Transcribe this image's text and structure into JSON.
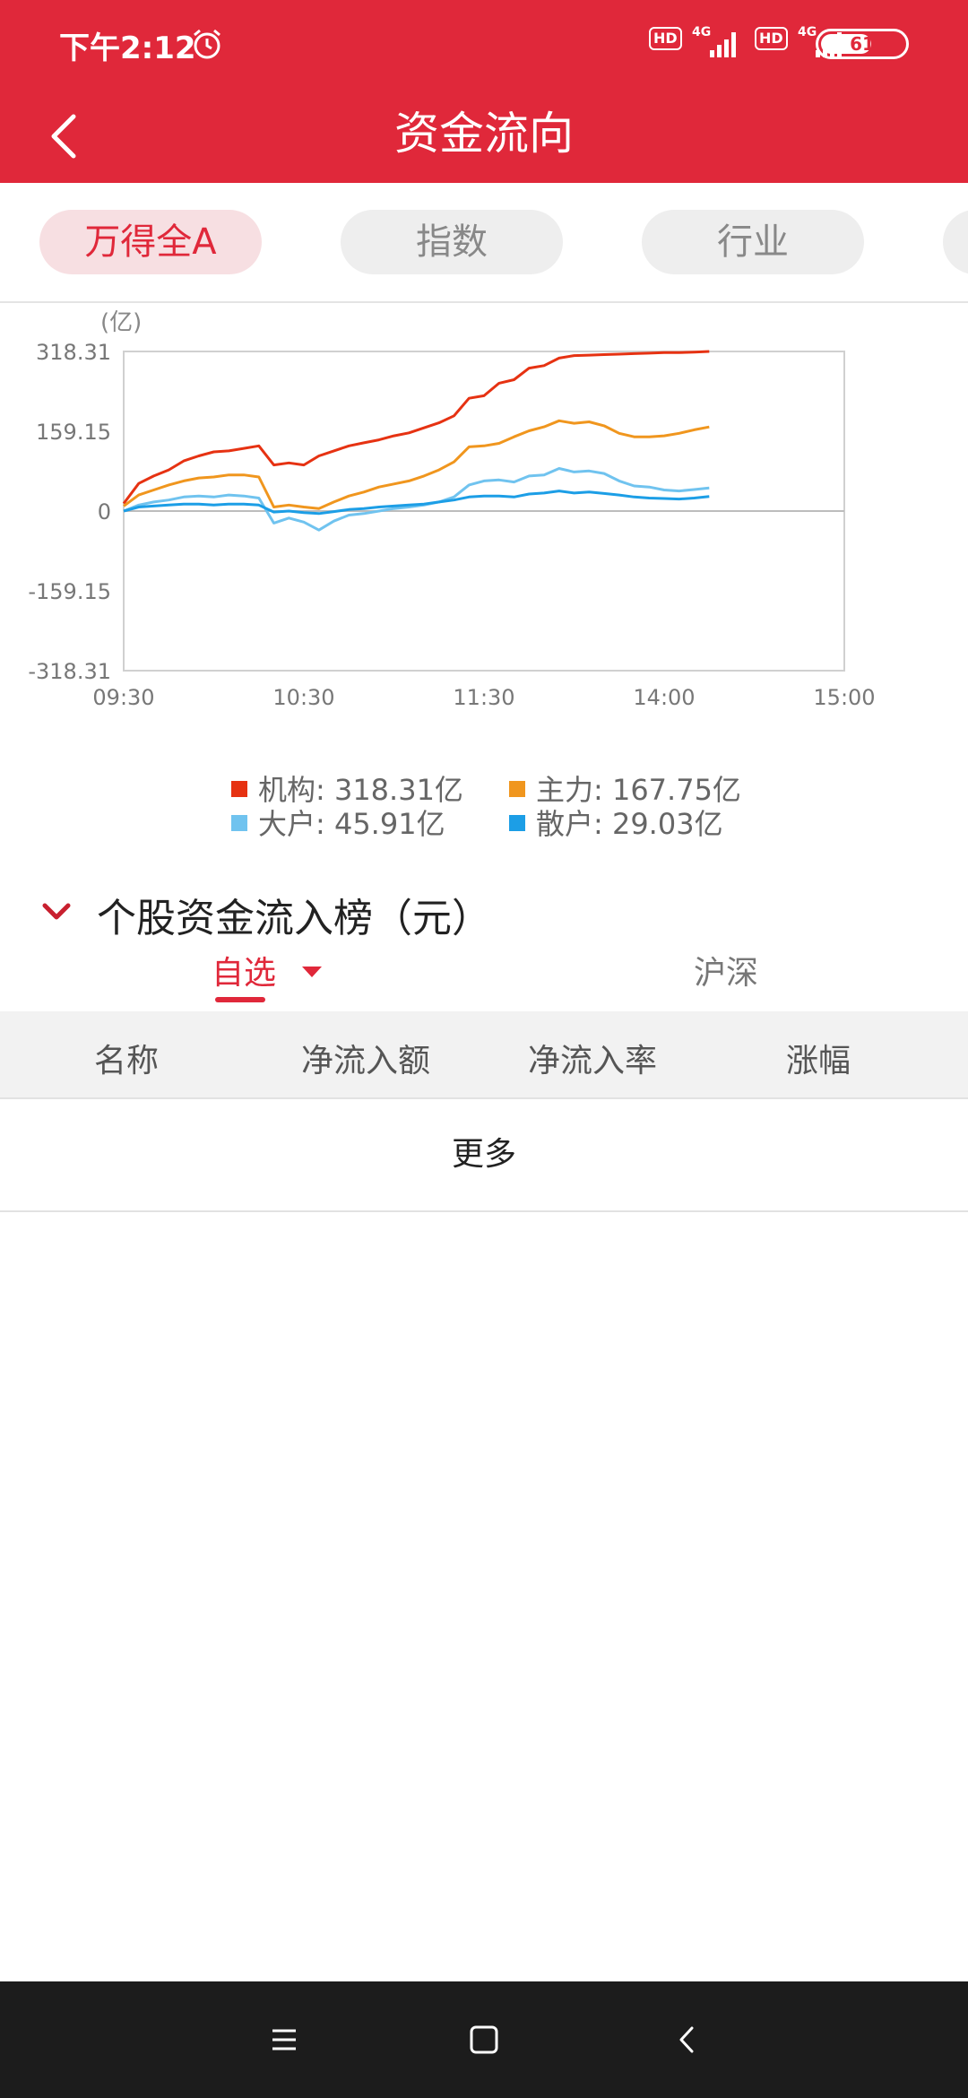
{
  "status": {
    "time": "下午2:12",
    "hd1": "HD",
    "hd2": "HD",
    "net1": "4G",
    "net2": "4G",
    "battery": "61",
    "battery_level": 0.61
  },
  "header": {
    "title": "资金流向"
  },
  "tabs": [
    {
      "label": "万得全A",
      "active": true
    },
    {
      "label": "指数"
    },
    {
      "label": "行业"
    }
  ],
  "chart_data": {
    "type": "line",
    "unit_label": "(亿)",
    "y_ticks": [
      "318.31",
      "159.15",
      "0",
      "-159.15",
      "-318.31"
    ],
    "ylim": [
      -318.31,
      318.31
    ],
    "x_ticks": [
      "09:30",
      "10:30",
      "11:30",
      "14:00",
      "15:00"
    ],
    "x": [
      "09:30",
      "09:35",
      "09:40",
      "09:45",
      "09:50",
      "09:55",
      "10:00",
      "10:05",
      "10:10",
      "10:15",
      "10:20",
      "10:25",
      "10:30",
      "10:35",
      "10:40",
      "10:45",
      "10:50",
      "10:55",
      "11:00",
      "11:05",
      "11:10",
      "11:15",
      "11:20",
      "11:25",
      "13:00",
      "13:05",
      "13:10",
      "13:15",
      "13:20",
      "13:25",
      "13:30",
      "13:35",
      "13:40",
      "13:45",
      "13:50",
      "13:55",
      "14:00",
      "14:05",
      "14:10",
      "14:15"
    ],
    "series": [
      {
        "name": "机构",
        "color": "#e63212",
        "values": [
          15,
          55,
          70,
          82,
          100,
          110,
          118,
          120,
          125,
          130,
          92,
          96,
          92,
          110,
          120,
          130,
          136,
          142,
          150,
          156,
          166,
          176,
          190,
          225,
          230,
          255,
          262,
          285,
          290,
          305,
          310,
          311,
          312,
          313,
          314,
          315,
          316,
          316,
          317,
          318.31
        ]
      },
      {
        "name": "主力",
        "color": "#f0961e",
        "values": [
          10,
          32,
          42,
          52,
          60,
          66,
          68,
          72,
          72,
          68,
          8,
          12,
          8,
          5,
          18,
          30,
          38,
          48,
          54,
          60,
          70,
          82,
          98,
          128,
          130,
          135,
          148,
          160,
          168,
          180,
          175,
          178,
          170,
          155,
          148,
          148,
          150,
          155,
          162,
          167.75
        ]
      },
      {
        "name": "大户",
        "color": "#70c3ef",
        "values": [
          0,
          12,
          18,
          22,
          28,
          30,
          28,
          32,
          30,
          26,
          -24,
          -14,
          -22,
          -38,
          -20,
          -8,
          -5,
          0,
          5,
          8,
          12,
          18,
          28,
          52,
          60,
          62,
          58,
          70,
          72,
          85,
          78,
          80,
          75,
          60,
          50,
          48,
          42,
          40,
          43,
          45.91
        ]
      },
      {
        "name": "散户",
        "color": "#1c9ee6",
        "values": [
          0,
          8,
          10,
          12,
          14,
          14,
          12,
          14,
          14,
          12,
          -2,
          0,
          -3,
          -5,
          -1,
          3,
          5,
          8,
          10,
          12,
          14,
          18,
          22,
          28,
          30,
          30,
          28,
          34,
          36,
          40,
          36,
          38,
          35,
          32,
          28,
          26,
          25,
          24,
          26,
          29.03
        ]
      }
    ]
  },
  "legend": [
    {
      "label": "机构: 318.31亿",
      "color": "#e63212"
    },
    {
      "label": "主力: 167.75亿",
      "color": "#f0961e"
    },
    {
      "label": "大户: 45.91亿",
      "color": "#70c3ef"
    },
    {
      "label": "散户: 29.03亿",
      "color": "#1c9ee6"
    }
  ],
  "section": {
    "title": "个股资金流入榜（元）"
  },
  "subtabs": {
    "left": "自选",
    "right": "沪深"
  },
  "table": {
    "headers": [
      "名称",
      "净流入额",
      "净流入率",
      "涨幅"
    ]
  },
  "more": "更多"
}
